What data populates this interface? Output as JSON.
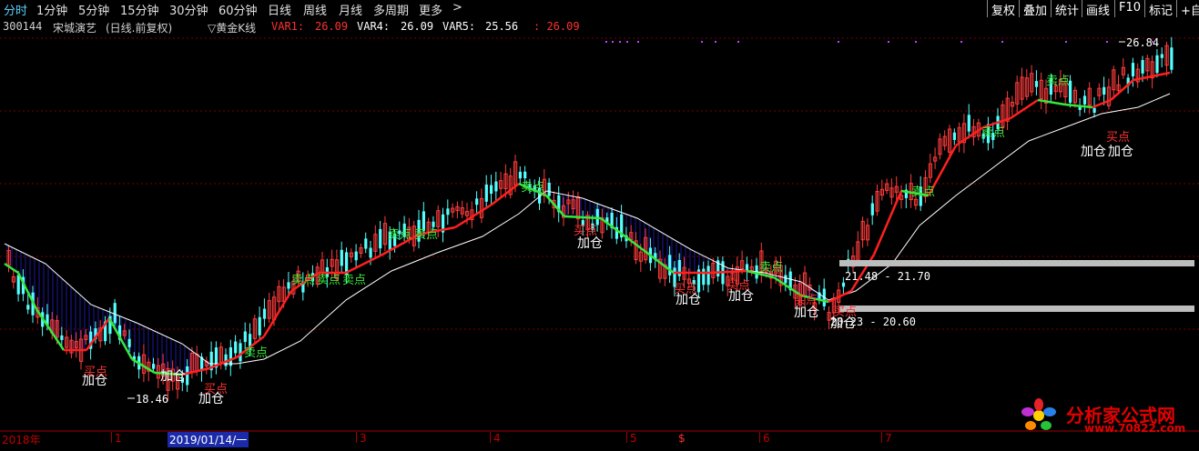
{
  "toolbar": {
    "periods": [
      {
        "label": "分时",
        "active": true
      },
      {
        "label": "1分钟"
      },
      {
        "label": "5分钟"
      },
      {
        "label": "15分钟"
      },
      {
        "label": "30分钟"
      },
      {
        "label": "60分钟"
      },
      {
        "label": "日线"
      },
      {
        "label": "周线"
      },
      {
        "label": "月线"
      },
      {
        "label": "多周期"
      },
      {
        "label": "更多"
      },
      {
        "label": ">"
      }
    ],
    "right_buttons": [
      "复权",
      "叠加",
      "统计",
      "画线",
      "F10",
      "标记",
      "+自选"
    ]
  },
  "info": {
    "code": "300144",
    "name": "宋城演艺",
    "period": "(日线.前复权)",
    "indicator": "▽黄金K线",
    "var1_label": "VAR1:",
    "var1_value": "26.09",
    "var4_label": "VAR4:",
    "var4_value": "26.09",
    "var5_label": "VAR5:",
    "var5_value": "25.56",
    "extra": ": 26.09"
  },
  "price_labels": {
    "high": "26.84",
    "low": "18.46",
    "zone1": "21.48 - 21.70",
    "zone2": "20.23 - 20.60"
  },
  "signals": {
    "sell": "卖点",
    "buy": "买点",
    "add": "加仓"
  },
  "xaxis": {
    "labels": [
      "2018年",
      "1",
      "2019/01/14/一",
      "3",
      "4",
      "5",
      "6",
      "7"
    ],
    "marker": "$"
  },
  "logo": {
    "text": "分析家公式网",
    "url": "www.70822.com"
  },
  "colors": {
    "background": "#000000",
    "up_candle": "#ff3b3b",
    "down_candle": "#54ffff",
    "ma_red": "#ff2020",
    "ma_green": "#36e83a",
    "ma_white": "#ffffff",
    "fill_blue": "#1a1aa0",
    "grid": "#7a0000",
    "zone_bar": "#bdbdbd",
    "sell_text": "#36e83a",
    "buy_text": "#ff3030",
    "add_text": "#ffffff"
  }
}
